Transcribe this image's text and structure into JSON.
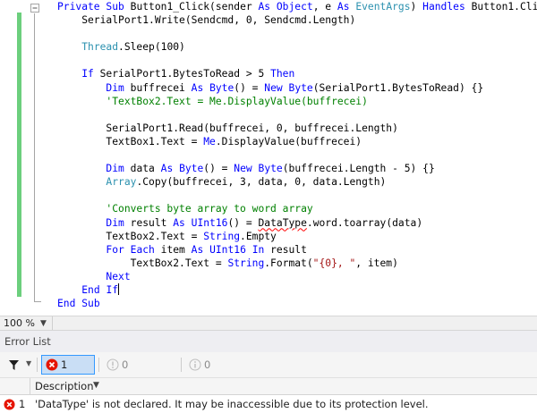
{
  "code_lines": [
    [
      {
        "t": "Private ",
        "c": "kw"
      },
      {
        "t": "Sub ",
        "c": "kw"
      },
      {
        "t": "Button1_Click(sender "
      },
      {
        "t": "As ",
        "c": "kw"
      },
      {
        "t": "Object",
        "c": "kw"
      },
      {
        "t": ", e "
      },
      {
        "t": "As ",
        "c": "kw"
      },
      {
        "t": "EventArgs",
        "c": "ty"
      },
      {
        "t": ") "
      },
      {
        "t": "Handles ",
        "c": "kw"
      },
      {
        "t": "Button1.Click"
      }
    ],
    [
      {
        "t": "    SerialPort1.Write(Sendcmd, 0, Sendcmd.Length)"
      }
    ],
    [],
    [
      {
        "t": "    "
      },
      {
        "t": "Thread",
        "c": "ty"
      },
      {
        "t": ".Sleep(100)"
      }
    ],
    [],
    [
      {
        "t": "    "
      },
      {
        "t": "If ",
        "c": "kw"
      },
      {
        "t": "SerialPort1.BytesToRead > 5 "
      },
      {
        "t": "Then",
        "c": "kw"
      }
    ],
    [
      {
        "t": "        "
      },
      {
        "t": "Dim ",
        "c": "kw"
      },
      {
        "t": "buffrecei "
      },
      {
        "t": "As ",
        "c": "kw"
      },
      {
        "t": "Byte",
        "c": "kw"
      },
      {
        "t": "() = "
      },
      {
        "t": "New ",
        "c": "kw"
      },
      {
        "t": "Byte",
        "c": "kw"
      },
      {
        "t": "(SerialPort1.BytesToRead) {}"
      }
    ],
    [
      {
        "t": "        "
      },
      {
        "t": "'TextBox2.Text = Me.DisplayValue(buffrecei)",
        "c": "cm"
      }
    ],
    [],
    [
      {
        "t": "        SerialPort1.Read(buffrecei, 0, buffrecei.Length)"
      }
    ],
    [
      {
        "t": "        TextBox1.Text = "
      },
      {
        "t": "Me",
        "c": "kw"
      },
      {
        "t": ".DisplayValue(buffrecei)"
      }
    ],
    [],
    [
      {
        "t": "        "
      },
      {
        "t": "Dim ",
        "c": "kw"
      },
      {
        "t": "data "
      },
      {
        "t": "As ",
        "c": "kw"
      },
      {
        "t": "Byte",
        "c": "kw"
      },
      {
        "t": "() = "
      },
      {
        "t": "New ",
        "c": "kw"
      },
      {
        "t": "Byte",
        "c": "kw"
      },
      {
        "t": "(buffrecei.Length - 5) {}"
      }
    ],
    [
      {
        "t": "        "
      },
      {
        "t": "Array",
        "c": "ty"
      },
      {
        "t": ".Copy(buffrecei, 3, data, 0, data.Length)"
      }
    ],
    [],
    [
      {
        "t": "        "
      },
      {
        "t": "'Converts byte array to word array",
        "c": "cm"
      }
    ],
    [
      {
        "t": "        "
      },
      {
        "t": "Dim ",
        "c": "kw"
      },
      {
        "t": "result "
      },
      {
        "t": "As ",
        "c": "kw"
      },
      {
        "t": "UInt16",
        "c": "kw"
      },
      {
        "t": "() = "
      },
      {
        "t": "DataType",
        "c": "squig"
      },
      {
        "t": ".word.toarray(data)"
      }
    ],
    [
      {
        "t": "        TextBox2.Text = "
      },
      {
        "t": "String",
        "c": "kw"
      },
      {
        "t": ".Empty"
      }
    ],
    [
      {
        "t": "        "
      },
      {
        "t": "For ",
        "c": "kw"
      },
      {
        "t": "Each ",
        "c": "kw"
      },
      {
        "t": "item "
      },
      {
        "t": "As ",
        "c": "kw"
      },
      {
        "t": "UInt16 ",
        "c": "kw"
      },
      {
        "t": "In ",
        "c": "kw"
      },
      {
        "t": "result"
      }
    ],
    [
      {
        "t": "            TextBox2.Text = "
      },
      {
        "t": "String",
        "c": "kw"
      },
      {
        "t": ".Format("
      },
      {
        "t": "\"{0}, \"",
        "c": "st"
      },
      {
        "t": ", item)"
      }
    ],
    [
      {
        "t": "        "
      },
      {
        "t": "Next",
        "c": "kw"
      }
    ],
    [
      {
        "t": "    "
      },
      {
        "t": "End ",
        "c": "kw"
      },
      {
        "t": "If",
        "c": "kw"
      },
      {
        "t": "",
        "c": "caret"
      }
    ],
    [
      {
        "t": "End ",
        "c": "kw"
      },
      {
        "t": "Sub",
        "c": "kw"
      }
    ]
  ],
  "zoom": {
    "value": "100 %"
  },
  "error_list": {
    "title": "Error List",
    "errors_label": "1 Error",
    "warnings_label": "0 Warnings",
    "messages_label": "0 Messages",
    "column_description": "Description",
    "rows": [
      {
        "number": "1",
        "description": "'DataType' is not declared. It may be inaccessible due to its protection level."
      }
    ]
  },
  "colors": {
    "keyword": "#0000ff",
    "type": "#2b91af",
    "comment": "#008000",
    "string": "#a31515",
    "change_bar": "#6ccf7d",
    "error_red": "#e51400"
  }
}
